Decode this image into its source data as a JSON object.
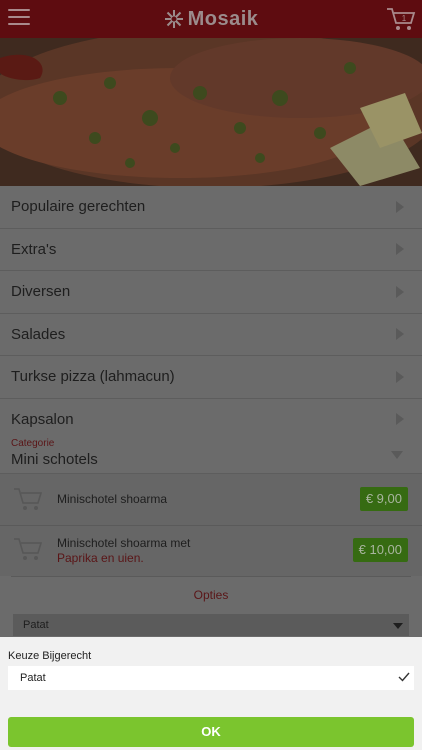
{
  "header": {
    "logo_text": "Mosaik",
    "menu_icon": "hamburger-icon",
    "cart_icon": "cart-icon",
    "brand_color": "#5e0c10"
  },
  "categories": [
    {
      "label": "Populaire gerechten"
    },
    {
      "label": "Extra's"
    },
    {
      "label": "Diversen"
    },
    {
      "label": "Salades"
    },
    {
      "label": "Turkse pizza (lahmacun)"
    },
    {
      "label": "Kapsalon"
    }
  ],
  "open_category": {
    "caption": "Categorie",
    "title": "Mini schotels"
  },
  "items": [
    {
      "name": "Minischotel shoarma",
      "description": "",
      "price": "€ 9,00"
    },
    {
      "name": "Minischotel shoarma met",
      "description": "Paprika en uien.",
      "price": "€ 10,00"
    }
  ],
  "options": {
    "heading": "Opties",
    "select_value": "Patat"
  },
  "picker": {
    "label": "Keuze Bijgerecht",
    "selected": "Patat",
    "ok_label": "OK",
    "accent": "#7bc52e"
  }
}
